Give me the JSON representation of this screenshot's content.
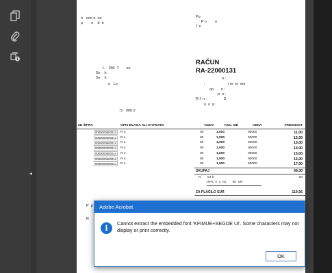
{
  "dialog": {
    "title": "Adobe Acrobat",
    "message": "Cannot extract the embedded font 'KFIMUE+SEGOE UI'. Some characters may not display or print correctly.",
    "ok_label": "OK",
    "icon": "info-icon"
  },
  "rail": {
    "icons": [
      "copy-pages-icon",
      "attachment-icon",
      "stamp-icon"
    ],
    "collapse_glyph": "◂"
  },
  "document": {
    "header_left": [
      "n   ono o  oo",
      "p        n    b  n"
    ],
    "header_right": [
      "Po",
      "     P o        o",
      "T n"
    ],
    "seller": [
      "L    RM  T       oo",
      "Sv    h",
      "Sv    h",
      "o   Lo"
    ],
    "title": "RAČUN",
    "number": "RA-22000131",
    "info": [
      "n :",
      ":                      i m  ni  om",
      "op       n :",
      "p  o :",
      "R f  n :                S",
      "o  o  p :"
    ],
    "total_line": ":S   000 0",
    "columns": [
      "ZE ŠIFRA",
      "OPIS BLAGA ALI STORITEV",
      "%DDV",
      "KOL. ME",
      "CENA",
      "VREDNOST"
    ],
    "rows": [
      {
        "code": "0000000000014",
        "desc": "R    o",
        "ddv": "00",
        "kol": "1,000",
        "cena": "00000",
        "value": "11,00"
      },
      {
        "code": "0000000000014",
        "desc": "R    o",
        "ddv": "00",
        "kol": "1,000",
        "cena": "00000",
        "value": "12,00"
      },
      {
        "code": "0000000000014",
        "desc": "R    o",
        "ddv": "00",
        "kol": "1,000",
        "cena": "00000",
        "value": "13,00"
      },
      {
        "code": "0000000000014",
        "desc": "R    o",
        "ddv": "00",
        "kol": "1,000",
        "cena": "00000",
        "value": "14,00"
      },
      {
        "code": "0000000000014",
        "desc": "R    o",
        "ddv": "00",
        "kol": "1,000",
        "cena": "00000",
        "value": "15,00"
      },
      {
        "code": "0000000000014",
        "desc": "R    o",
        "ddv": "00",
        "kol": "1,000",
        "cena": "00000",
        "value": "16,00"
      },
      {
        "code": "0000000000014",
        "desc": "R    o",
        "ddv": "00",
        "kol": "1,000",
        "cena": "00000",
        "value": "17,00"
      }
    ],
    "skupaj_label": "SKUPAJ",
    "skupaj_value": "98,00",
    "tax_line1": "R       ST b",
    "tax_line1_value": "00",
    "tax_line2": "00%  o  o  no       00  UR",
    "za_placilo_label": "ZA PLAČILO EUR",
    "za_placilo_value": "119,56",
    "footer_p": "P  p",
    "footer_r": "R"
  }
}
